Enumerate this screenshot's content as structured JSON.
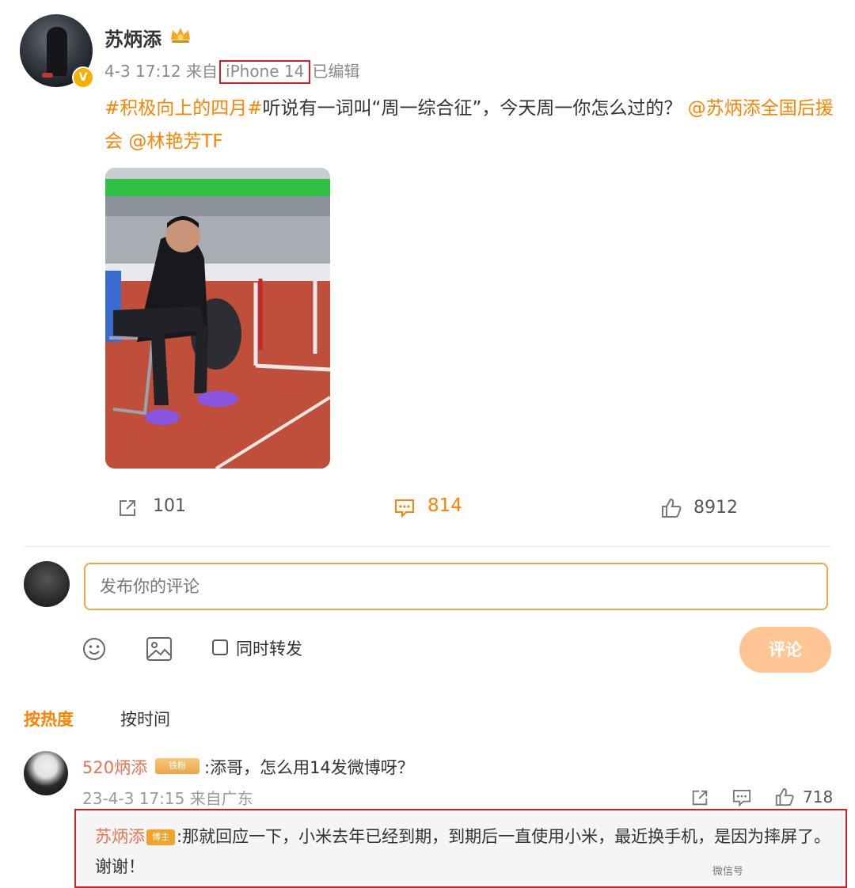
{
  "post": {
    "author": "苏炳添",
    "time": "4-3 17:12",
    "source_prefix": "来自",
    "device": "iPhone 14",
    "edited": "已编辑",
    "hashtag": "#积极向上的四月#",
    "text_main": "听说有一词叫“周一综合征”，今天周一你怎么过的？",
    "mention1": "@苏炳添全国后援会",
    "mention2": "@林艳芳TF"
  },
  "stats": {
    "reposts": "101",
    "comments": "814",
    "likes": "8912"
  },
  "composer": {
    "placeholder": "发布你的评论",
    "repost_label": "同时转发",
    "submit_label": "评论"
  },
  "sort": {
    "hot": "按热度",
    "time": "按时间"
  },
  "comment": {
    "user": "520炳添",
    "badge": "铁粉",
    "text": ":添哥，怎么用14发微博呀？",
    "time": "23-4-3 17:15",
    "location": "来自广东",
    "likes": "718"
  },
  "reply": {
    "user": "苏炳添",
    "badge": "博主",
    "text": ":那就回应一下，小米去年已经到期，到期后一直使用小米，最近换手机，是因为摔屏了。谢谢！"
  },
  "watermark": "微信号",
  "colors": {
    "accent": "#ff8200",
    "name_color": "#eb7350",
    "highlight_border": "#d0202a",
    "input_border": "#f0a64a",
    "button_bg": "#ffc592"
  }
}
